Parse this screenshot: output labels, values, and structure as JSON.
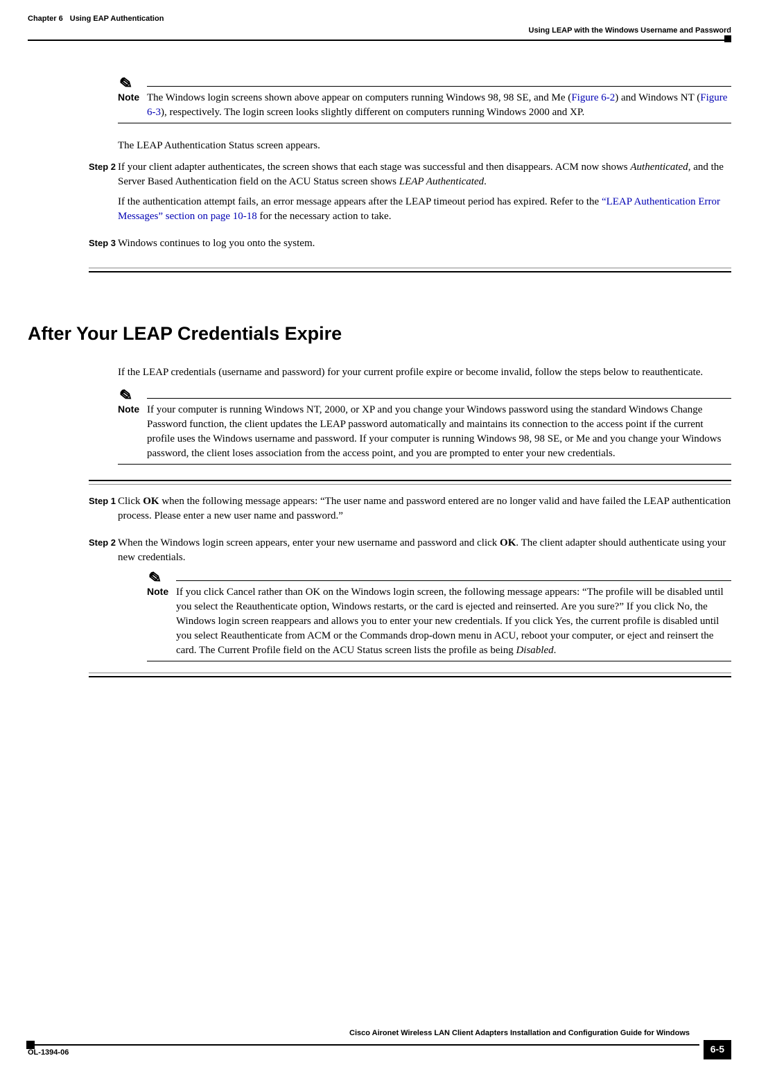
{
  "header": {
    "chapter": "Chapter 6",
    "chapter_title": "Using EAP Authentication",
    "section": "Using LEAP with the Windows Username and Password"
  },
  "note1": {
    "label": "Note",
    "text_part1": "The Windows login screens shown above appear on computers running Windows 98, 98 SE, and Me (",
    "fig62": "Figure 6-2",
    "text_part2": ") and Windows NT (",
    "fig63": "Figure 6-3",
    "text_part3": "), respectively. The login screen looks slightly different on computers running Windows 2000 and XP."
  },
  "para_leap_status": "The LEAP Authentication Status screen appears.",
  "step2a": {
    "label": "Step 2",
    "p1_a": "If your client adapter authenticates, the screen shows that each stage was successful and then disappears. ACM now shows ",
    "p1_b": "Authenticated",
    "p1_c": ", and the Server Based Authentication field on the ACU Status screen shows ",
    "p1_d": "LEAP Authenticated",
    "p1_e": ".",
    "p2_a": "If the authentication attempt fails, an error message appears after the LEAP timeout period has expired. Refer to the ",
    "p2_link": "“LEAP Authentication Error Messages” section on page 10-18",
    "p2_b": " for the necessary action to take."
  },
  "step3a": {
    "label": "Step 3",
    "text": "Windows continues to log you onto the system."
  },
  "heading": "After Your LEAP Credentials Expire",
  "para_intro": "If the LEAP credentials (username and password) for your current profile expire or become invalid, follow the steps below to reauthenticate.",
  "note2": {
    "label": "Note",
    "text": "If your computer is running Windows NT, 2000, or XP and you change your Windows password using the standard Windows Change Password function, the client updates the LEAP password automatically and maintains its connection to the access point if the current profile uses the Windows username and password. If your computer is running Windows 98, 98 SE, or Me and you change your Windows password, the client loses association from the access point, and you are prompted to enter your new credentials."
  },
  "step1b": {
    "label": "Step 1",
    "text_a": "Click ",
    "ok": "OK",
    "text_b": " when the following message appears: “The user name and password entered are no longer valid and have failed the LEAP authentication process. Please enter a new user name and password.”"
  },
  "step2b": {
    "label": "Step 2",
    "text_a": "When the Windows login screen appears, enter your new username and password and click ",
    "ok": "OK",
    "text_b": ". The client adapter should authenticate using your new credentials."
  },
  "note3": {
    "label": "Note",
    "text_a": "If you click Cancel rather than OK on the Windows login screen, the following message appears: “The profile will be disabled until you select the Reauthenticate option, Windows restarts, or the card is ejected and reinserted. Are you sure?” If you click No, the Windows login screen reappears and allows you to enter your new credentials. If you click Yes, the current profile is disabled until you select Reauthenticate from ACM or the Commands drop-down menu in ACU, reboot your computer, or eject and reinsert the card. The Current Profile field on the ACU Status screen lists the profile as being ",
    "disabled": "Disabled",
    "text_b": "."
  },
  "footer": {
    "guide": "Cisco Aironet Wireless LAN Client Adapters Installation and Configuration Guide for Windows",
    "doc": "OL-1394-06",
    "page": "6-5"
  }
}
